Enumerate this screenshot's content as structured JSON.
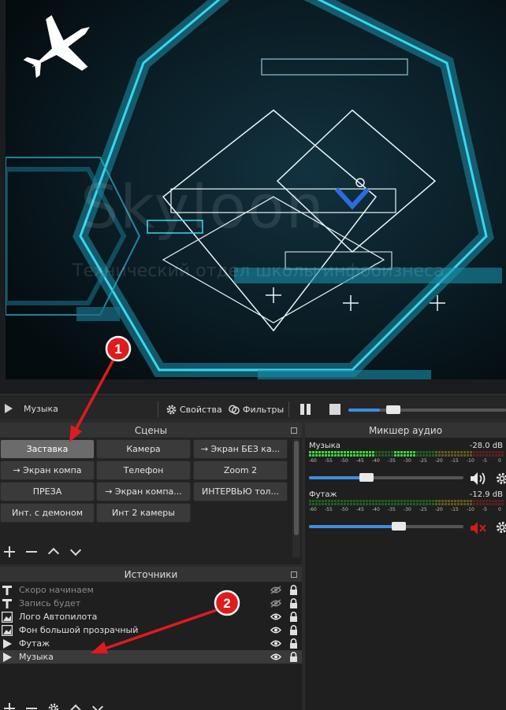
{
  "media_controls": {
    "source_name": "Музыка",
    "properties_label": "Свойства",
    "filters_label": "Фильтры",
    "progress": 0.2
  },
  "scenes": {
    "title": "Сцены",
    "items": [
      {
        "label": "Заставка",
        "active": true
      },
      {
        "label": "Камера"
      },
      {
        "label": "→ Экран БЕЗ ка..."
      },
      {
        "label": "→ Экран компа"
      },
      {
        "label": "Телефон"
      },
      {
        "label": "Zoom 2"
      },
      {
        "label": "ПРЕЗА"
      },
      {
        "label": "→ Экран компа..."
      },
      {
        "label": "ИНТЕРВЬЮ тол..."
      },
      {
        "label": "Инт. с демоном"
      },
      {
        "label": "Инт 2 камеры"
      }
    ]
  },
  "sources": {
    "title": "Источники",
    "items": [
      {
        "type": "text-icon",
        "name": "Скоро начинаем",
        "visible": false,
        "locked": true
      },
      {
        "type": "text-icon",
        "name": "Запись будет",
        "visible": false,
        "locked": true
      },
      {
        "type": "image-icon",
        "name": "Лого Автопилота",
        "visible": true,
        "locked": true
      },
      {
        "type": "image-icon",
        "name": "Фон большой прозрачный",
        "visible": true,
        "locked": true
      },
      {
        "type": "media-icon",
        "name": "Футаж",
        "visible": true,
        "locked": true
      },
      {
        "type": "media-icon",
        "name": "Музыка",
        "visible": true,
        "locked": true,
        "selected": true
      }
    ]
  },
  "mixer": {
    "title": "Микшер аудио",
    "tick_labels": [
      "-60",
      "-55",
      "-50",
      "-45",
      "-40",
      "-35",
      "-30",
      "-25",
      "-20",
      "-15",
      "-10",
      "-5",
      "0"
    ],
    "channels": [
      {
        "name": "Музыка",
        "db": "-28.0 dB",
        "volume": 0.37,
        "muted": false
      },
      {
        "name": "Футаж",
        "db": "-12.9 dB",
        "volume": 0.58,
        "muted": true
      }
    ]
  },
  "preview": {
    "watermark": "Skyloon",
    "watermark_sub": "Технический отдел школы инфобизнеса"
  },
  "annotations": {
    "badge_1": "1",
    "badge_2": "2"
  },
  "colors": {
    "accent": "#3d8ee0",
    "meter_green": "#3dd63d",
    "annotation_red": "#e01b1b",
    "preview_cyan": "#2ad4f0"
  }
}
